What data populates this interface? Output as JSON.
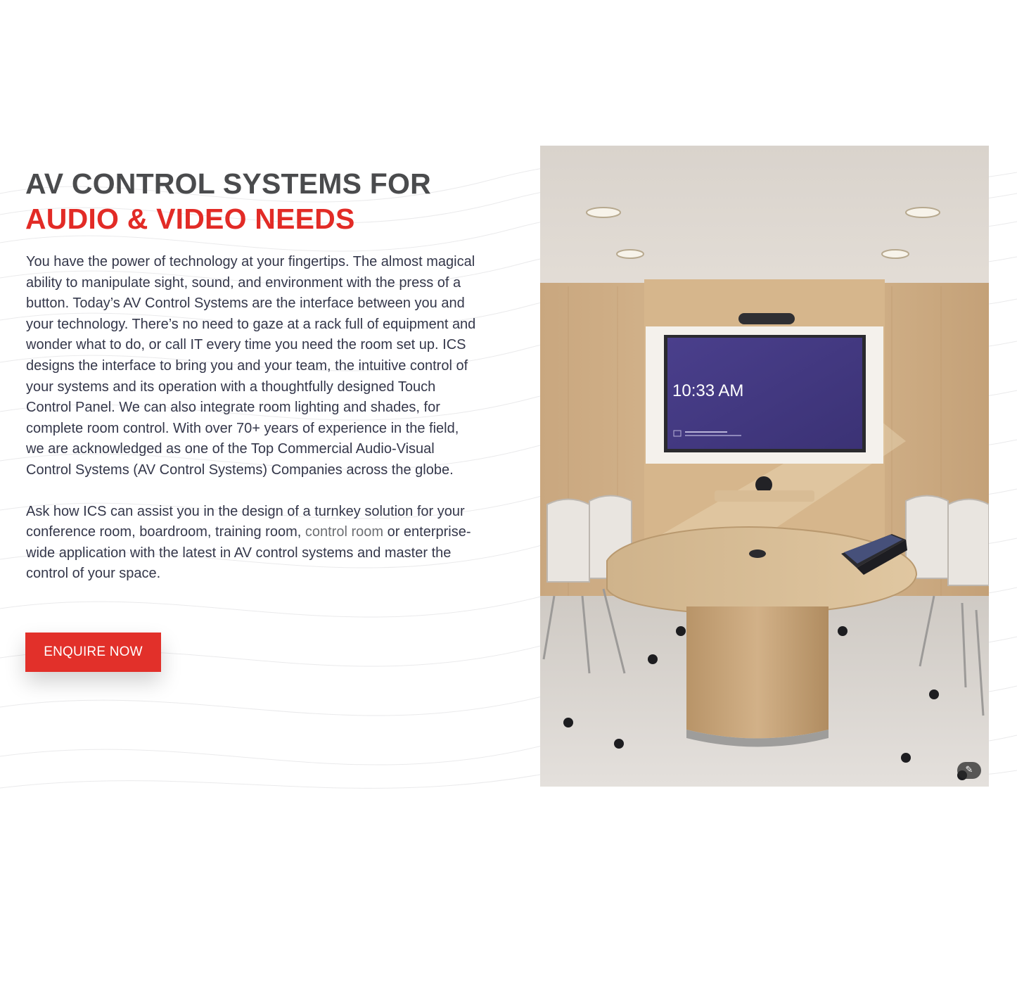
{
  "section": {
    "heading_line1": "AV CONTROL SYSTEMS FOR",
    "heading_line2": "AUDIO & VIDEO NEEDS",
    "paragraph1": "You have the power of technology at your fingertips. The almost magical ability to manipulate sight, sound, and environment with the press of a button. Today’s AV Control Systems are the interface between you and your technology. There’s no need to gaze at a rack full of equipment and wonder what to do, or call IT every time you need the room set up. ICS designs the interface to bring you and your team, the intuitive control of your systems and its operation with a thoughtfully designed Touch Control Panel. We can also integrate room lighting and shades, for complete room control. With over 70+ years of experience in the field, we are acknowledged as one of the Top Commercial Audio-Visual Control Systems (AV Control Systems) Companies across the globe.",
    "paragraph2_before_link": "Ask how ICS can assist you in the design of a turnkey solution for your conference room, boardroom, training room, ",
    "paragraph2_link": "control room",
    "paragraph2_after_link": " or enterprise-wide application with the latest in AV control systems and master the control of your space.",
    "cta_label": "ENQUIRE NOW"
  },
  "photo": {
    "display_time": "10:33 AM",
    "edit_icon": "magic-wand-icon"
  },
  "colors": {
    "heading_dark": "#4a4b4d",
    "accent_red": "#e22b26",
    "body_text": "#34374a"
  }
}
